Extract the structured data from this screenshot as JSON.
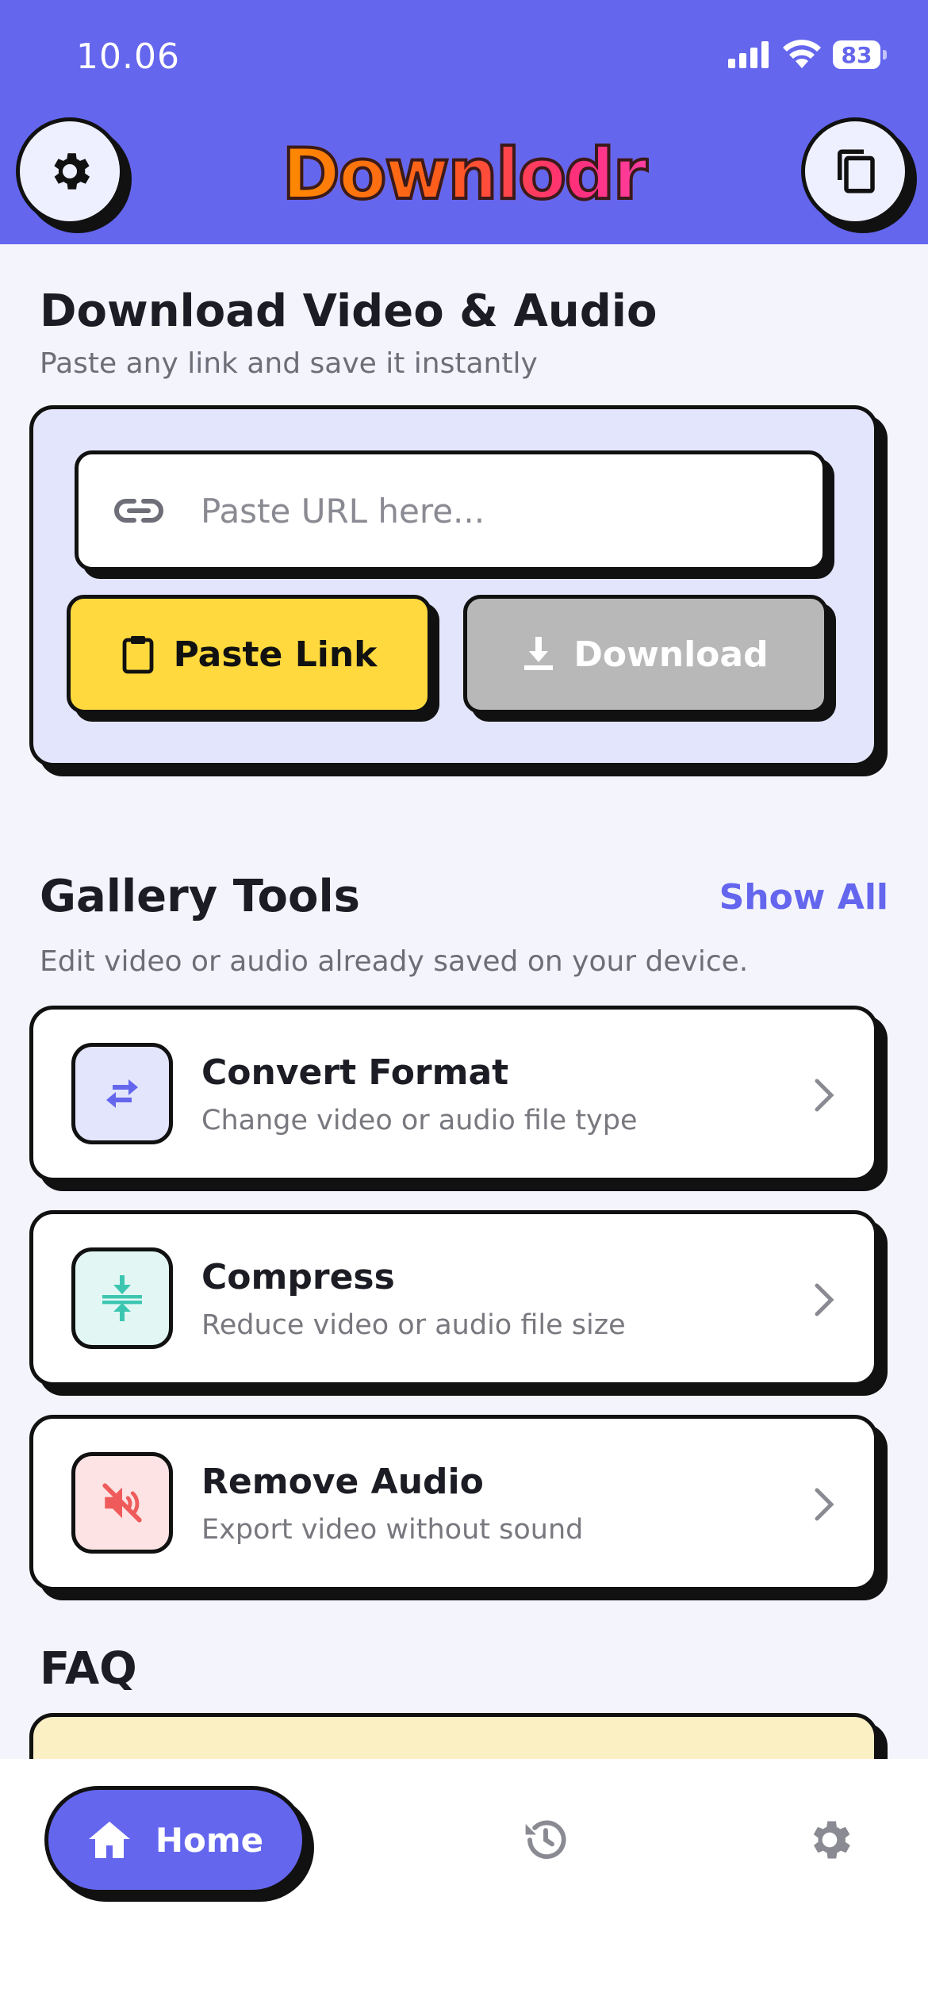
{
  "status_bar": {
    "time": "10.06",
    "battery": "83"
  },
  "header": {
    "logo": "Downlodr"
  },
  "download_section": {
    "title": "Download Video & Audio",
    "subtitle": "Paste any link and save it instantly",
    "url_placeholder": "Paste URL here...",
    "paste_label": "Paste Link",
    "download_label": "Download"
  },
  "gallery": {
    "title": "Gallery Tools",
    "show_all": "Show All",
    "subtitle": "Edit video or audio already saved on your device.",
    "tools": [
      {
        "title": "Convert Format",
        "desc": "Change video or audio file type",
        "icon": "swap-arrows-icon",
        "color": "#e3e5fd"
      },
      {
        "title": "Compress",
        "desc": "Reduce video or audio file size",
        "icon": "compress-icon",
        "color": "#e2f7f4"
      },
      {
        "title": "Remove Audio",
        "desc": "Export video without sound",
        "icon": "mute-icon",
        "color": "#fde3e3"
      }
    ]
  },
  "faq": {
    "title": "FAQ"
  },
  "nav": {
    "home_label": "Home"
  },
  "colors": {
    "accent": "#6466ee",
    "paste": "#ffd93d",
    "download_disabled": "#b8b8b8",
    "page_bg": "#f4f4fd"
  }
}
